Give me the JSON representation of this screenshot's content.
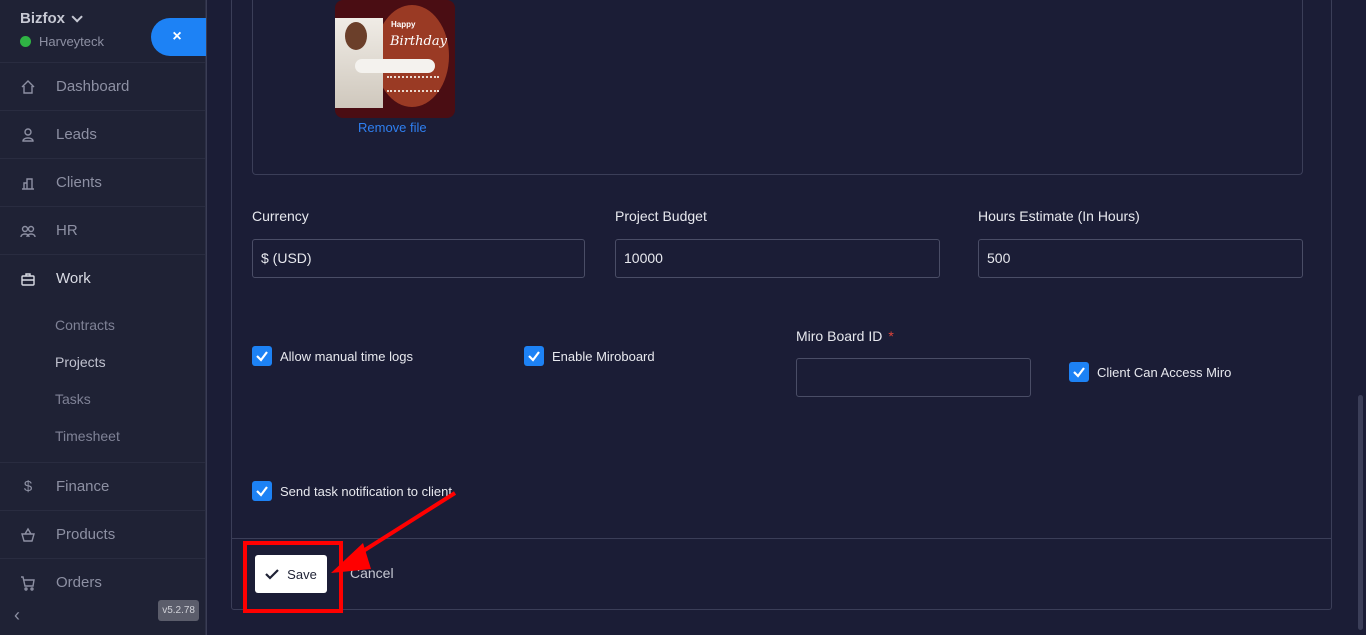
{
  "sidebar": {
    "brand": "Bizfox",
    "workspace": "Harveyteck",
    "close_label": "×",
    "items": [
      {
        "label": "Dashboard",
        "icon": "home-icon"
      },
      {
        "label": "Leads",
        "icon": "user-icon"
      },
      {
        "label": "Clients",
        "icon": "building-icon"
      },
      {
        "label": "HR",
        "icon": "users-icon"
      },
      {
        "label": "Work",
        "icon": "briefcase-icon"
      },
      {
        "label": "Finance",
        "icon": "dollar-icon"
      },
      {
        "label": "Products",
        "icon": "basket-icon"
      },
      {
        "label": "Orders",
        "icon": "cart-icon"
      }
    ],
    "work_subitems": [
      "Contracts",
      "Projects",
      "Tasks",
      "Timesheet"
    ],
    "version": "v5.2.78",
    "collapse_icon": "chevron-left-icon"
  },
  "upload": {
    "image_text_1": "Happy",
    "image_text_2": "Birthday",
    "remove_label": "Remove file"
  },
  "form": {
    "currency": {
      "label": "Currency",
      "value": "$ (USD)"
    },
    "budget": {
      "label": "Project Budget",
      "value": "10000"
    },
    "hours": {
      "label": "Hours Estimate (In Hours)",
      "value": "500"
    },
    "miro_id": {
      "label": "Miro Board ID",
      "required": "*",
      "value": ""
    },
    "checks": {
      "manual_time_logs": "Allow manual time logs",
      "enable_miro": "Enable Miroboard",
      "client_miro": "Client Can Access Miro",
      "task_notification": "Send task notification to client"
    }
  },
  "actions": {
    "save": "Save",
    "cancel": "Cancel"
  },
  "colors": {
    "accent": "#1d82f5",
    "highlight": "#ff0000",
    "background": "#1b1d36"
  }
}
